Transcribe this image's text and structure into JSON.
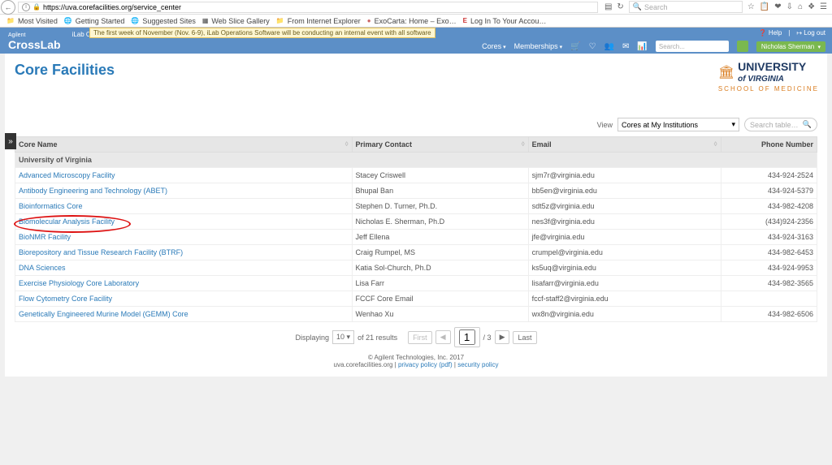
{
  "browser": {
    "url": "https://uva.corefacilities.org/service_center",
    "search_placeholder": "Search",
    "bookmarks": [
      "Most Visited",
      "Getting Started",
      "Suggested Sites",
      "Web Slice Gallery",
      "From Internet Explorer",
      "ExoCarta: Home – Exo…",
      "Log In To Your Accou…"
    ]
  },
  "header": {
    "brand_top": "Agilent",
    "brand": "CrossLab",
    "subtitle": "iLab Operations Software",
    "banner": "The first week of November (Nov. 6-9), iLab Operations Software will be conducting an internal event with all software",
    "help": "Help",
    "logout": "Log out",
    "menus": [
      "Cores",
      "Memberships"
    ],
    "search_placeholder": "Search...",
    "user": "Nicholas Sherman"
  },
  "page": {
    "title": "Core Facilities",
    "uva1": "UNIVERSITY",
    "uva1b": "of VIRGINIA",
    "uva2": "SCHOOL OF MEDICINE",
    "view_label": "View",
    "view_value": "Cores at My Institutions",
    "search_placeholder": "Search table…"
  },
  "table": {
    "columns": [
      "Core Name",
      "Primary Contact",
      "Email",
      "Phone Number"
    ],
    "group": "University of Virginia",
    "rows": [
      {
        "name": "Advanced Microscopy Facility",
        "contact": "Stacey Criswell",
        "email": "sjm7r@virginia.edu",
        "phone": "434-924-2524"
      },
      {
        "name": "Antibody Engineering and Technology (ABET)",
        "contact": "Bhupal Ban",
        "email": "bb5en@virginia.edu",
        "phone": "434-924-5379"
      },
      {
        "name": "Bioinformatics Core",
        "contact": "Stephen D. Turner, Ph.D.",
        "email": "sdt5z@virginia.edu",
        "phone": "434-982-4208"
      },
      {
        "name": "Biomolecular Analysis Facility",
        "contact": "Nicholas E. Sherman, Ph.D",
        "email": "nes3f@virginia.edu",
        "phone": "(434)924-2356",
        "circled": true
      },
      {
        "name": "BioNMR Facility",
        "contact": "Jeff Ellena",
        "email": "jfe@virginia.edu",
        "phone": "434-924-3163"
      },
      {
        "name": "Biorepository and Tissue Research Facility (BTRF)",
        "contact": "Craig Rumpel, MS",
        "email": "crumpel@virginia.edu",
        "phone": "434-982-6453"
      },
      {
        "name": "DNA Sciences",
        "contact": "Katia Sol-Church, Ph.D",
        "email": "ks5uq@virginia.edu",
        "phone": "434-924-9953"
      },
      {
        "name": "Exercise Physiology Core Laboratory",
        "contact": "Lisa Farr",
        "email": "lisafarr@virginia.edu",
        "phone": "434-982-3565"
      },
      {
        "name": "Flow Cytometry Core Facility",
        "contact": "FCCF Core Email",
        "email": "fccf-staff2@virginia.edu",
        "phone": ""
      },
      {
        "name": "Genetically Engineered Murine Model (GEMM) Core",
        "contact": "Wenhao Xu",
        "email": "wx8n@virginia.edu",
        "phone": "434-982-6506"
      }
    ]
  },
  "pager": {
    "displaying": "Displaying",
    "size": "10",
    "of_results": "of 21 results",
    "first": "First",
    "page": "1",
    "total": "/ 3",
    "last": "Last"
  },
  "footer": {
    "copy": "© Agilent Technologies, Inc. 2017",
    "site": "uva.corefacilities.org",
    "privacy": "privacy policy (pdf)",
    "security": "security policy"
  }
}
